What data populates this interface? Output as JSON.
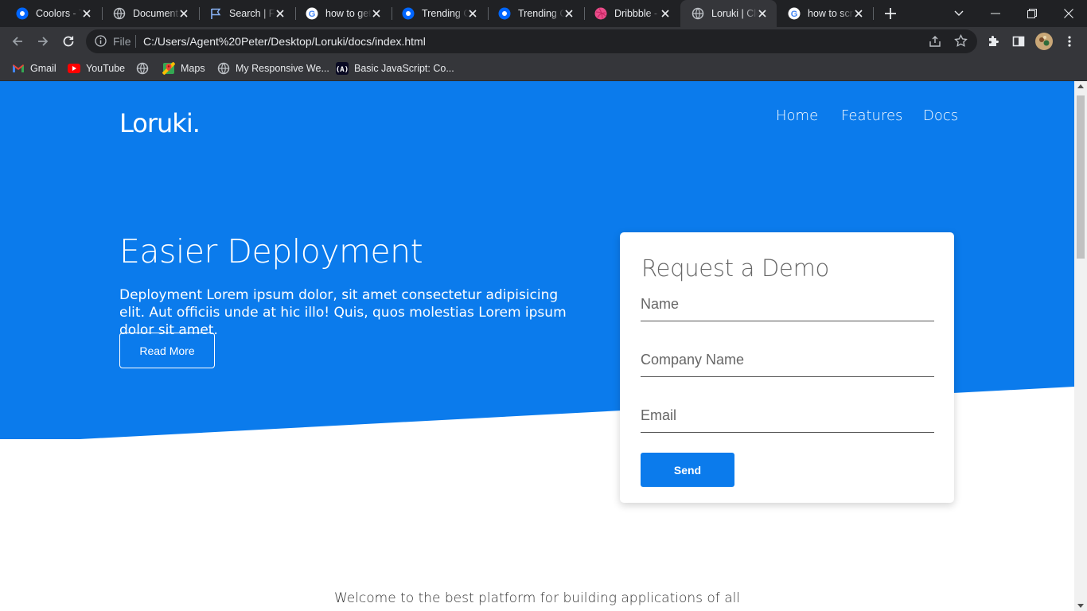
{
  "browser": {
    "tabs": [
      {
        "title": "Coolors - T",
        "icon": "coolors-icon"
      },
      {
        "title": "Document",
        "icon": "globe-icon"
      },
      {
        "title": "Search | Fo",
        "icon": "flag-icon"
      },
      {
        "title": "how to get",
        "icon": "google-icon"
      },
      {
        "title": "Trending C",
        "icon": "coolors-icon"
      },
      {
        "title": "Trending C",
        "icon": "coolors-icon"
      },
      {
        "title": "Dribbble -",
        "icon": "dribbble-icon"
      },
      {
        "title": "Loruki | Clo",
        "icon": "globe-icon",
        "active": true
      },
      {
        "title": "how to scr",
        "icon": "google-icon"
      }
    ],
    "address": {
      "scheme_label": "File",
      "url": "C:/Users/Agent%20Peter/Desktop/Loruki/docs/index.html"
    },
    "bookmarks": [
      {
        "label": "Gmail",
        "icon": "gmail-icon"
      },
      {
        "label": "YouTube",
        "icon": "youtube-icon"
      },
      {
        "label": "",
        "icon": "globe-icon"
      },
      {
        "label": "Maps",
        "icon": "maps-icon"
      },
      {
        "label": "My Responsive We...",
        "icon": "globe-icon"
      },
      {
        "label": "Basic JavaScript: Co...",
        "icon": "freecodecamp-icon"
      }
    ]
  },
  "page": {
    "logo": "Loruki.",
    "nav": {
      "home": "Home",
      "features": "Features",
      "docs": "Docs"
    },
    "hero": {
      "title": "Easier Deployment",
      "text": "Deployment Lorem ipsum dolor, sit amet consectetur adipisicing elit. Aut officiis unde at hic illo! Quis, quos molestias Lorem ipsum dolor sit amet.",
      "button": "Read More"
    },
    "demo_form": {
      "title": "Request a Demo",
      "name_placeholder": "Name",
      "company_placeholder": "Company Name",
      "email_placeholder": "Email",
      "send_button": "Send"
    },
    "welcome": "Welcome to the best platform for building applications of all"
  },
  "colors": {
    "primary": "#0b7bec",
    "chrome_dark": "#202124",
    "chrome_mid": "#35363a"
  }
}
